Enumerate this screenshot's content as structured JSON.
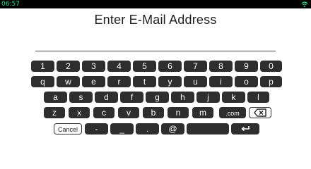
{
  "status": {
    "time": "06:57",
    "wifi_icon": "wifi-icon"
  },
  "title": "Enter E-Mail Address",
  "email_value": "",
  "keyboard": {
    "row1": [
      "1",
      "2",
      "3",
      "4",
      "5",
      "6",
      "7",
      "8",
      "9",
      "0"
    ],
    "row2": [
      "q",
      "w",
      "e",
      "r",
      "t",
      "y",
      "u",
      "i",
      "o",
      "p"
    ],
    "row3": [
      "a",
      "s",
      "d",
      "f",
      "g",
      "h",
      "j",
      "k",
      "l"
    ],
    "row4": [
      "z",
      "x",
      "c",
      "v",
      "b",
      "n",
      "m",
      ".com"
    ],
    "row5": {
      "cancel": "Cancel",
      "dash": "-",
      "underscore": "_",
      "dot": ".",
      "at": "@",
      "space": "",
      "backspace_icon": "backspace-icon",
      "enter_icon": "enter-icon"
    }
  },
  "colors": {
    "key": "#2e2e2e",
    "key_text": "#ffffff",
    "clock": "#2fe08a"
  }
}
